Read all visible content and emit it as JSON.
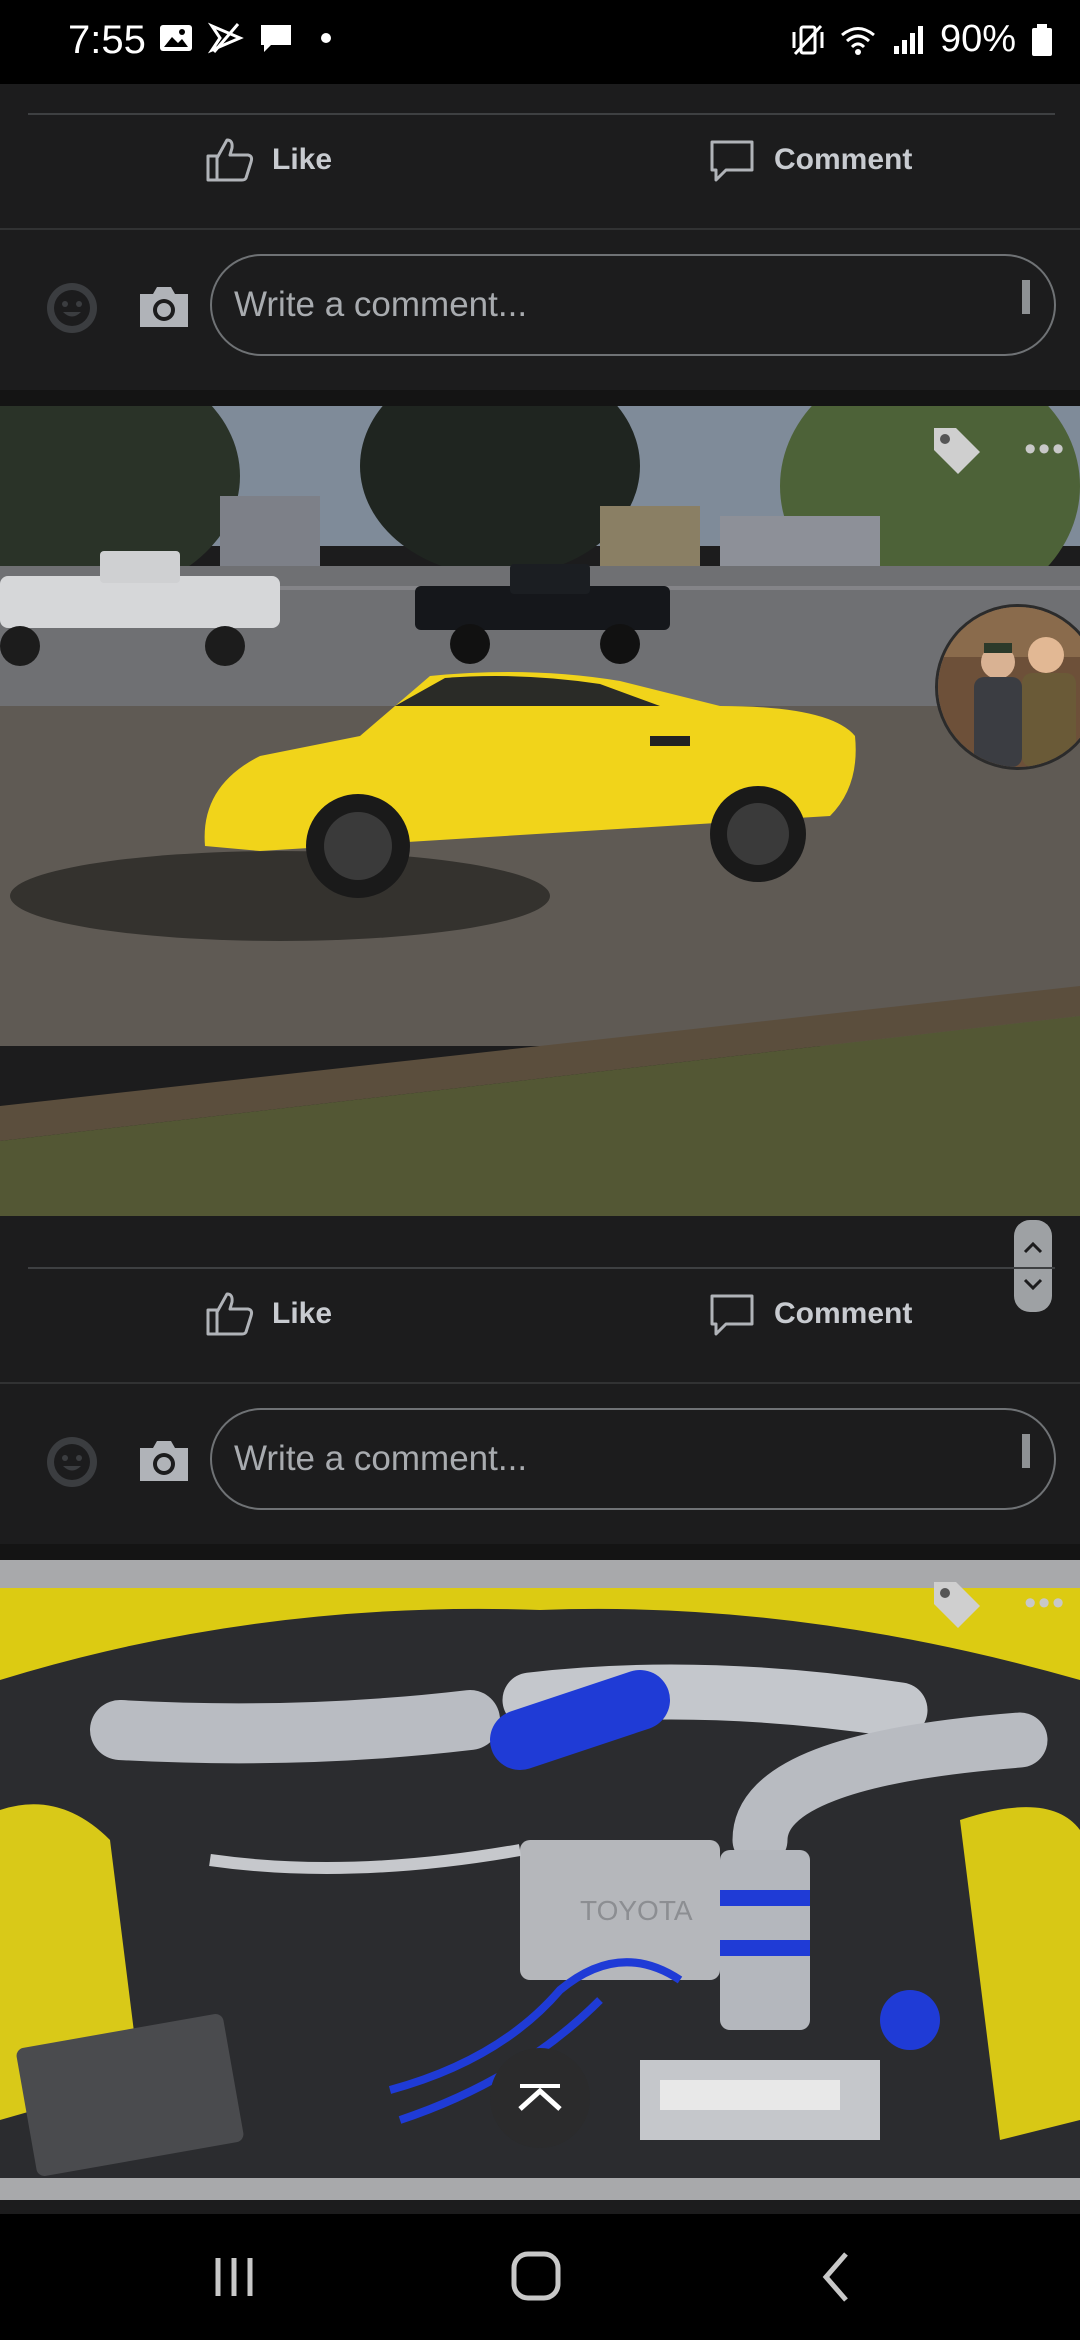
{
  "status_bar": {
    "time": "7:55",
    "battery": "90%",
    "icons_left": [
      "gallery-icon",
      "mute-arrow-icon",
      "message-icon",
      "dot-icon"
    ],
    "icons_right": [
      "vibrate-icon",
      "wifi-icon",
      "signal-icon",
      "battery-icon"
    ]
  },
  "posts": [
    {
      "like_label": "Like",
      "comment_label": "Comment",
      "comment_placeholder": "Write a comment..."
    },
    {
      "like_label": "Like",
      "comment_label": "Comment",
      "comment_placeholder": "Write a comment..."
    }
  ],
  "photo_descriptions": {
    "photo_1": "yellow-sports-car-photo",
    "photo_2": "engine-bay-photo"
  },
  "engine_plate_text": "TOYOTA",
  "colors": {
    "background": "#1c1c1d",
    "divider": "#3e4042",
    "text_secondary": "#c8cbd0",
    "car_yellow": "#f1d41a",
    "hose_blue": "#1f3bd6"
  },
  "nav": [
    "recent-apps",
    "home",
    "back"
  ]
}
